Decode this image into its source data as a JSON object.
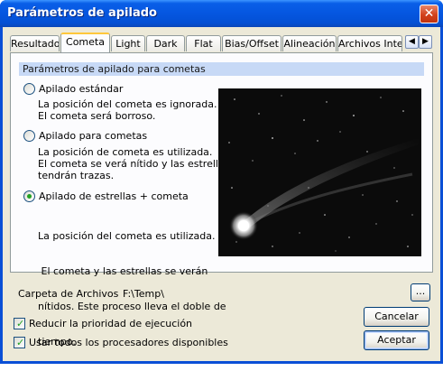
{
  "window": {
    "title": "Parámetros de apilado",
    "close_symbol": "✕"
  },
  "tabs": [
    {
      "label": "Resultado"
    },
    {
      "label": "Cometa",
      "active": true
    },
    {
      "label": "Light"
    },
    {
      "label": "Dark"
    },
    {
      "label": "Flat"
    },
    {
      "label": "Bias/Offset"
    },
    {
      "label": "Alineación"
    },
    {
      "label": "Archivos Interr"
    }
  ],
  "tab_scroll": {
    "left": "◀",
    "right": "▶"
  },
  "group": {
    "header": "Parámetros de apilado para cometas"
  },
  "options": [
    {
      "label": "Apilado estándar",
      "checked": false,
      "description": [
        "La posición del cometa es ignorada.",
        "El cometa será borroso."
      ]
    },
    {
      "label": "Apilado para cometas",
      "checked": false,
      "description": [
        "La posición de cometa es utilizada.",
        "El cometa se verá nítido y las estrellas",
        "tendrán trazas."
      ]
    },
    {
      "label": "Apilado de estrellas + cometa",
      "checked": true,
      "description": [
        "La posición del cometa es utilizada.",
        " El cometa y las estrellas se verán",
        "nítidos. Este proceso lleva el doble de",
        "tiempo."
      ]
    }
  ],
  "folder": {
    "label": "Carpeta de Archivos",
    "value": "F:\\Temp\\",
    "browse_label": "..."
  },
  "checkboxes": [
    {
      "label": "Reducir la prioridad de ejecución",
      "checked": true
    },
    {
      "label": "Usar todos los procesadores disponibles",
      "checked": true
    }
  ],
  "buttons": {
    "cancel": "Cancelar",
    "ok": "Aceptar"
  },
  "colors": {
    "title_bar": "#0556e0",
    "dialog_bg": "#ece9d8",
    "group_header": "#c7d9f6",
    "active_tab_accent": "#ffc73c"
  }
}
